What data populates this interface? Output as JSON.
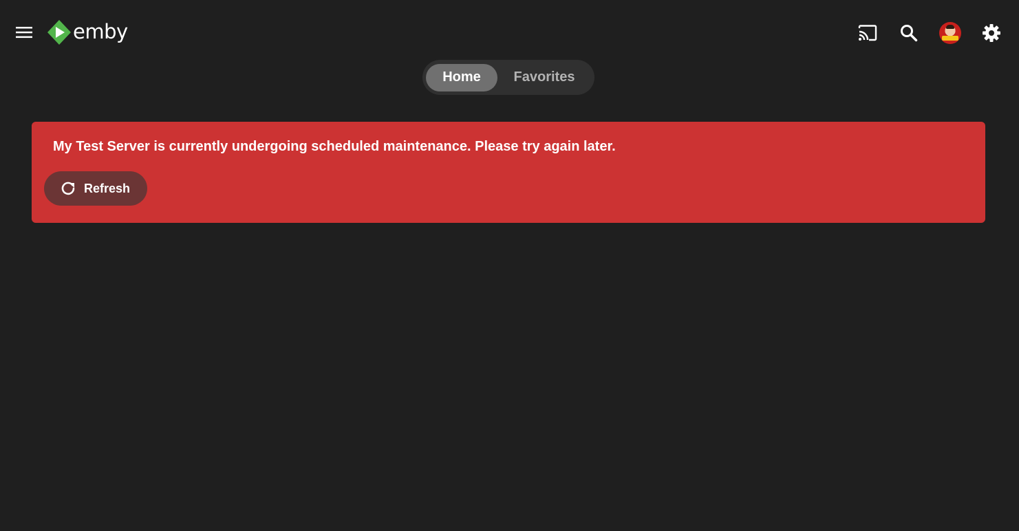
{
  "header": {
    "logo_text": "emby",
    "icons": {
      "menu": "hamburger-menu-icon",
      "cast": "cast-icon",
      "search": "search-icon",
      "avatar": "user-avatar",
      "settings": "gear-icon"
    }
  },
  "tabs": [
    {
      "label": "Home",
      "active": true
    },
    {
      "label": "Favorites",
      "active": false
    }
  ],
  "alert": {
    "message": "My Test Server is currently undergoing scheduled maintenance. Please try again later.",
    "button_label": "Refresh",
    "button_icon": "refresh-icon"
  },
  "colors": {
    "background": "#1f1f1f",
    "brand_green": "#52b54b",
    "alert_red": "#cc3333",
    "alert_button": "#6b3535",
    "tab_active": "#707070",
    "tab_track": "#303030"
  }
}
